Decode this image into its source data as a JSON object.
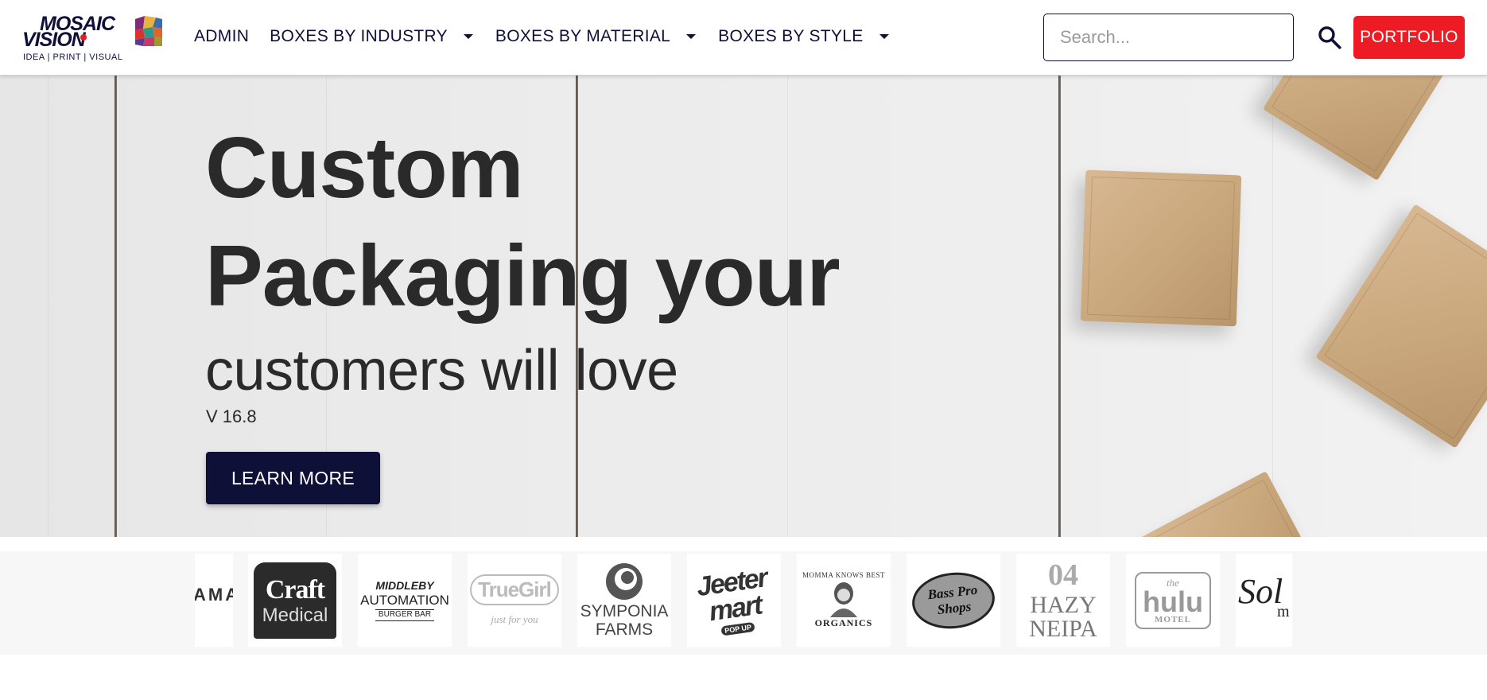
{
  "brand": {
    "line1": "MOSAIC",
    "line2": "VISION",
    "tagline": "IDEA | PRINT | VISUAL",
    "colors": {
      "navy": "#0f1038",
      "red": "#ed1c24"
    }
  },
  "nav": {
    "items": [
      {
        "label": "ADMIN"
      },
      {
        "label": "BOXES BY INDUSTRY"
      },
      {
        "label": "BOXES BY MATERIAL"
      },
      {
        "label": "BOXES BY STYLE"
      }
    ],
    "search": {
      "placeholder": "Search...",
      "value": ""
    },
    "search_icon": "search-icon",
    "portfolio_label": "PORTFOLIO"
  },
  "hero": {
    "title_line1": "Custom",
    "title_line2": "Packaging your",
    "subtitle": "customers will love",
    "version": "V 16.8",
    "cta_label": "LEARN MORE"
  },
  "clients": [
    {
      "name": "AMA",
      "sub": ""
    },
    {
      "name": "Craft",
      "sub": "Medical"
    },
    {
      "name": "MIDDLEBY",
      "sub": "AUTOMATION",
      "sub2": "BURGER BAR"
    },
    {
      "name": "TrueGirl",
      "sub": "just for you"
    },
    {
      "name": "SYMPONIA",
      "sub": "FARMS"
    },
    {
      "name": "Jeeter",
      "sub": "mart",
      "sub2": "POP UP"
    },
    {
      "name": "MOMMA KNOWS BEST",
      "sub": "ORGANICS"
    },
    {
      "name": "Bass Pro",
      "sub": "Shops"
    },
    {
      "name": "04",
      "sub": "HAZY",
      "sub2": "NEIPA"
    },
    {
      "name": "the",
      "sub": "hulu",
      "sub2": "MOTEL"
    },
    {
      "name": "Sol",
      "sub": "m"
    }
  ]
}
